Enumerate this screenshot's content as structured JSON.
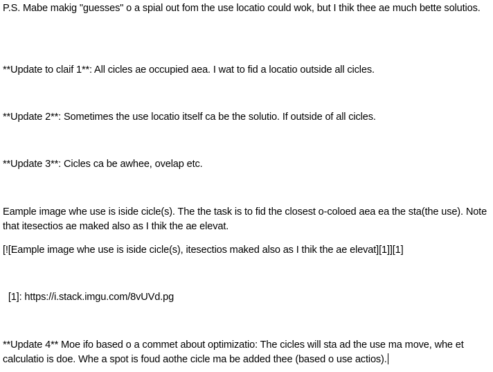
{
  "document": {
    "paragraphs": [
      "P.S. Mabe makig \"guesses\" o a spial out fom the use locatio could wok, but I thik thee ae much bette solutios.",
      "**Update to claif 1**: All cicles ae occupied aea. I wat to fid a locatio outside all cicles.",
      "**Update 2**: Sometimes the use locatio itself ca be the solutio. If outside of all cicles.",
      "**Update 3**: Cicles ca be awhee, ovelap etc.",
      "Eample image whe use is iside cicle(s). The the task is to fid the closest o-coloed aea ea the sta(the use). Note that itesectios ae maked also as I thik the ae elevat.",
      "[![Eample image whe use is iside cicle(s), itesectios maked also as I thik the ae elevat][1]][1]",
      "  [1]: https://i.stack.imgu.com/8vUVd.pg",
      "**Update 4** Moe ifo based o a commet about optimizatio: The cicles will sta ad the use ma move, whe et calculatio is doe. Whe a spot is foud aothe cicle ma be added thee (based o use actios)."
    ]
  }
}
